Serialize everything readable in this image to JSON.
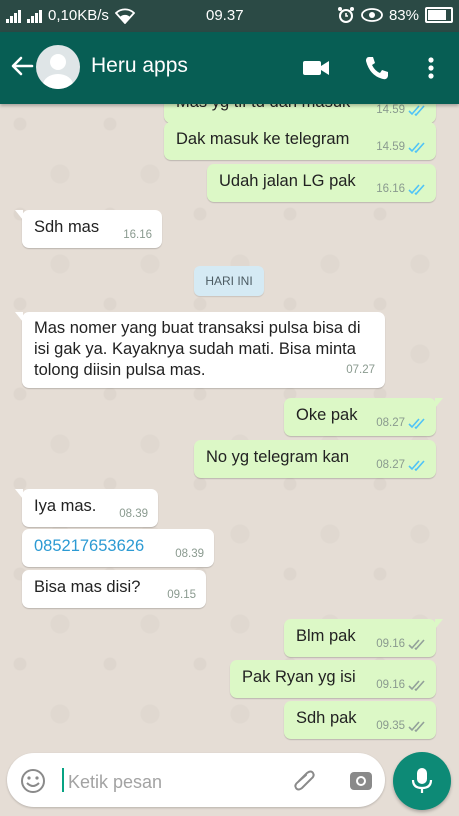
{
  "status_bar": {
    "network_speed": "0,10KB/s",
    "time": "09.37",
    "battery": "83%"
  },
  "header": {
    "contact_name": "Heru apps"
  },
  "date_divider": "HARI INI",
  "messages": [
    {
      "text": "Mas yg tlf td dah masuk",
      "time": "14.59",
      "dir": "out",
      "ticks": "blue"
    },
    {
      "text": "Dak masuk ke telegram",
      "time": "14.59",
      "dir": "out",
      "ticks": "blue"
    },
    {
      "text": "Udah jalan LG pak",
      "time": "16.16",
      "dir": "out",
      "ticks": "blue"
    },
    {
      "text": "Sdh mas",
      "time": "16.16",
      "dir": "in"
    },
    {
      "text": "Mas nomer yang buat transaksi pulsa bisa di isi gak ya. Kayaknya sudah mati. Bisa minta tolong diisin pulsa mas.",
      "time": "07.27",
      "dir": "in"
    },
    {
      "text": "Oke pak",
      "time": "08.27",
      "dir": "out",
      "ticks": "blue"
    },
    {
      "text": "No yg telegram kan",
      "time": "08.27",
      "dir": "out",
      "ticks": "blue"
    },
    {
      "text": "Iya mas.",
      "time": "08.39",
      "dir": "in"
    },
    {
      "text": "085217653626",
      "time": "08.39",
      "dir": "in"
    },
    {
      "text": "Bisa mas disi?",
      "time": "09.15",
      "dir": "in"
    },
    {
      "text": "Blm pak",
      "time": "09.16",
      "dir": "out",
      "ticks": "grey"
    },
    {
      "text": "Pak Ryan yg isi",
      "time": "09.16",
      "dir": "out",
      "ticks": "grey"
    },
    {
      "text": "Sdh pak",
      "time": "09.35",
      "dir": "out",
      "ticks": "grey"
    }
  ],
  "composer": {
    "placeholder": "Ketik pesan"
  },
  "colors": {
    "header": "#075e54",
    "status_bar": "#2b4a45",
    "outgoing_bubble": "#dcf8c6",
    "incoming_bubble": "#ffffff",
    "read_tick": "#4fc3f7",
    "mic_button": "#0d8a76"
  },
  "icons": [
    "signal-icon",
    "wifi-icon",
    "alarm-icon",
    "eye-icon",
    "battery-icon",
    "back-arrow-icon",
    "video-call-icon",
    "phone-icon",
    "more-vert-icon",
    "emoji-icon",
    "attach-icon",
    "camera-icon",
    "mic-icon"
  ]
}
